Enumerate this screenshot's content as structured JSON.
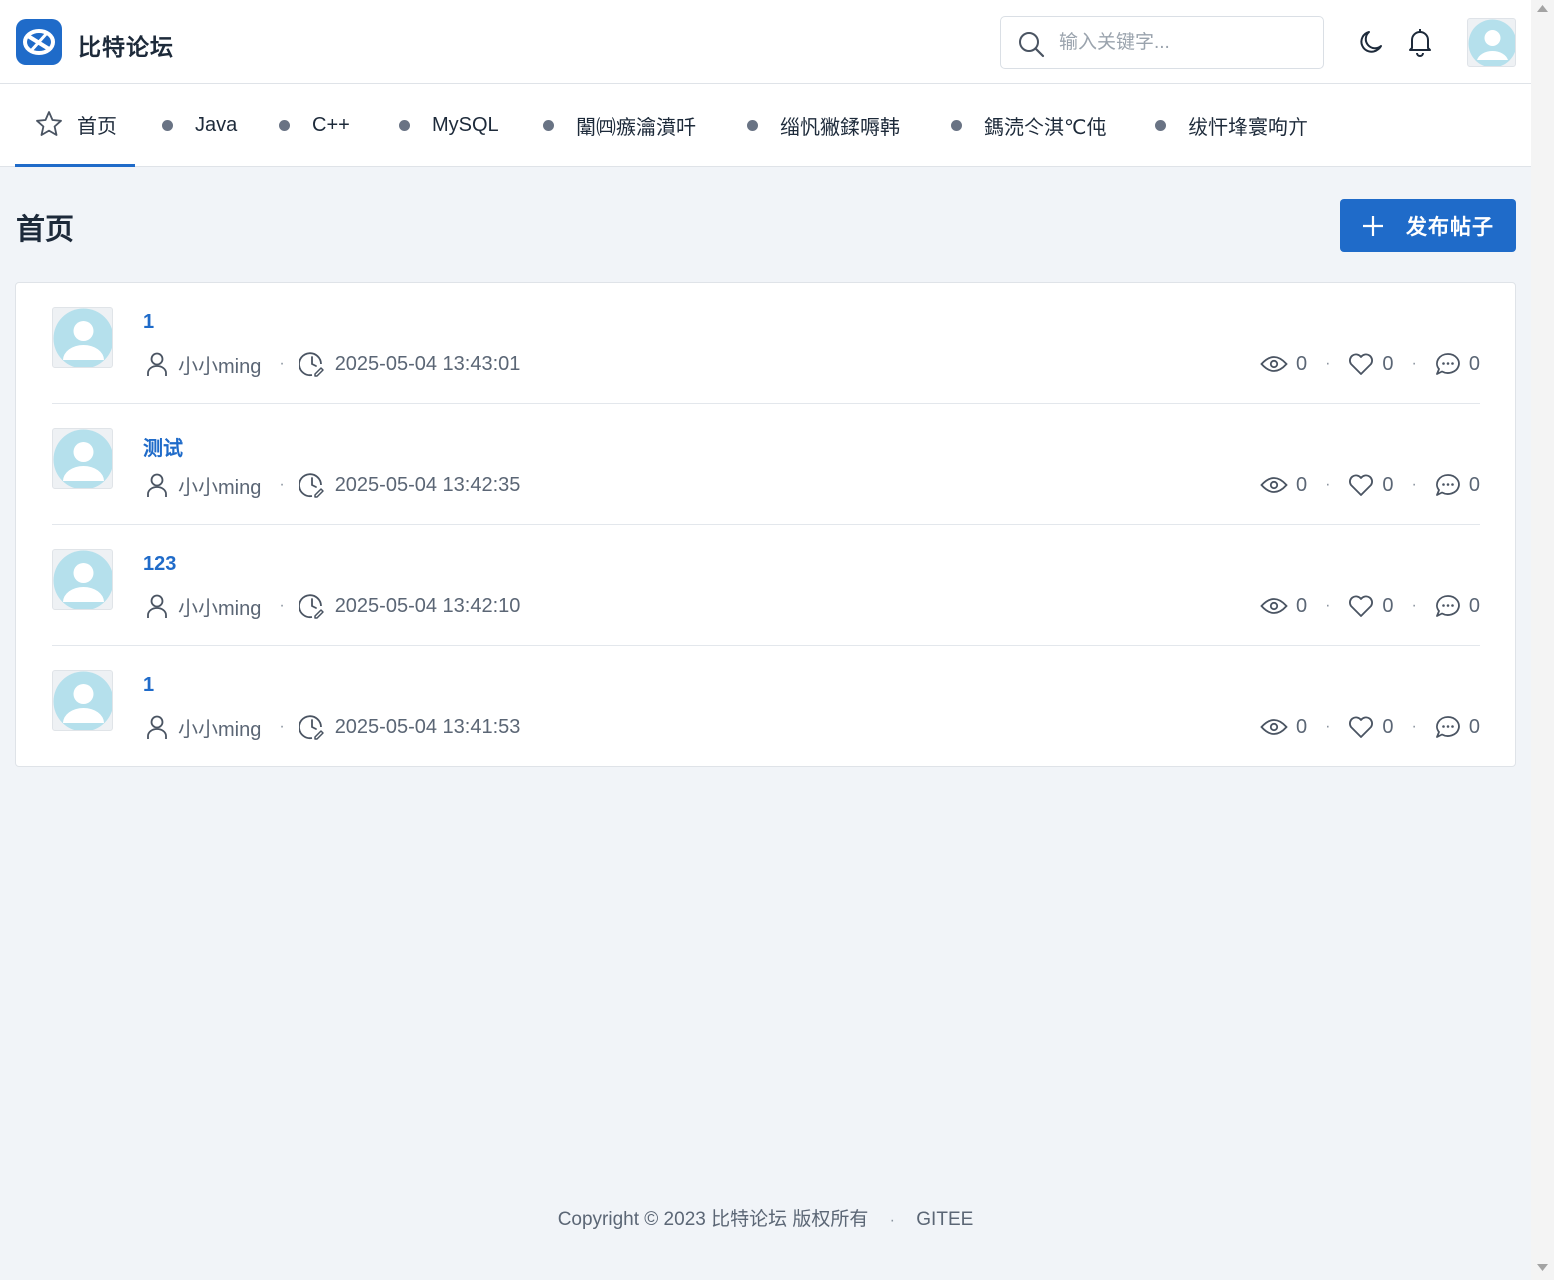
{
  "brand": {
    "name": "比特论坛"
  },
  "search": {
    "placeholder": "输入关键字..."
  },
  "nav": {
    "items": [
      {
        "label": "首页",
        "active": true
      },
      {
        "label": "Java"
      },
      {
        "label": "C++"
      },
      {
        "label": "MySQL"
      },
      {
        "label": "闈㈣瘯瀹濆吀"
      },
      {
        "label": "缁忛獙鍒嗕韩"
      },
      {
        "label": "鎷涜仒淇℃伅"
      },
      {
        "label": "绂忓埄寰呴亣"
      }
    ]
  },
  "main": {
    "title": "首页",
    "post_button": "发布帖子",
    "posts": [
      {
        "title": "1",
        "author": "小小ming",
        "time": "2025-05-04 13:43:01",
        "views": "0",
        "likes": "0",
        "comments": "0"
      },
      {
        "title": "测试",
        "author": "小小ming",
        "time": "2025-05-04 13:42:35",
        "views": "0",
        "likes": "0",
        "comments": "0"
      },
      {
        "title": "123",
        "author": "小小ming",
        "time": "2025-05-04 13:42:10",
        "views": "0",
        "likes": "0",
        "comments": "0"
      },
      {
        "title": "1",
        "author": "小小ming",
        "time": "2025-05-04 13:41:53",
        "views": "0",
        "likes": "0",
        "comments": "0"
      }
    ]
  },
  "footer": {
    "copyright": "Copyright © 2023 比特论坛 版权所有",
    "link": "GITEE"
  },
  "colors": {
    "primary": "#1f6bc9",
    "background": "#f1f4f8",
    "avatar": "#b5e0ec"
  },
  "icons": [
    "logo-icon",
    "search-icon",
    "moon-icon",
    "bell-icon",
    "star-icon",
    "plus-icon",
    "user-icon",
    "clock-icon",
    "eye-icon",
    "heart-icon",
    "comment-icon"
  ]
}
